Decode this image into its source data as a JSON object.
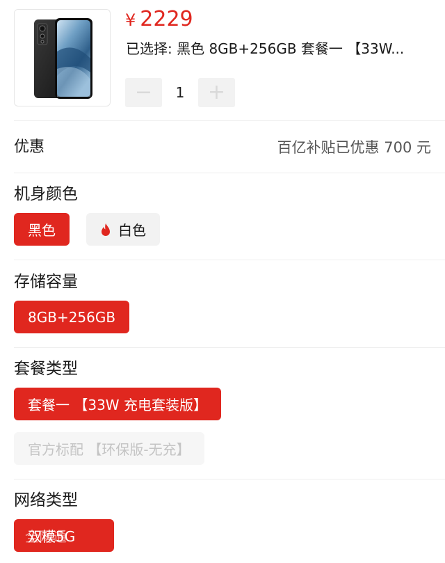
{
  "product": {
    "currency_symbol": "¥",
    "price": "2229",
    "selected_summary": "已选择: 黑色 8GB+256GB 套餐一 【33W...",
    "quantity": "1",
    "minus_label": "−",
    "plus_label": "+"
  },
  "promo": {
    "label": "优惠",
    "value": "百亿补贴已优惠 700 元"
  },
  "sections": {
    "color": {
      "title": "机身颜色",
      "options": [
        {
          "label": "黑色",
          "state": "selected"
        },
        {
          "label": "白色",
          "state": "normal",
          "icon": "flame-icon"
        }
      ]
    },
    "storage": {
      "title": "存储容量",
      "options": [
        {
          "label": "8GB+256GB",
          "state": "selected"
        }
      ]
    },
    "package": {
      "title": "套餐类型",
      "options": [
        {
          "label": "套餐一 【33W 充电套装版】",
          "state": "selected"
        },
        {
          "label": "官方标配 【环保版-无充】",
          "state": "disabled"
        }
      ]
    },
    "network": {
      "title": "网络类型",
      "options": [
        {
          "label": "双模5G",
          "state": "selected",
          "overlap_label": "全网通"
        }
      ]
    }
  },
  "colors": {
    "accent": "#e0271f",
    "chip_bg": "#f2f2f2",
    "disabled_text": "#c4c4c4",
    "divider": "#eeeeee"
  }
}
